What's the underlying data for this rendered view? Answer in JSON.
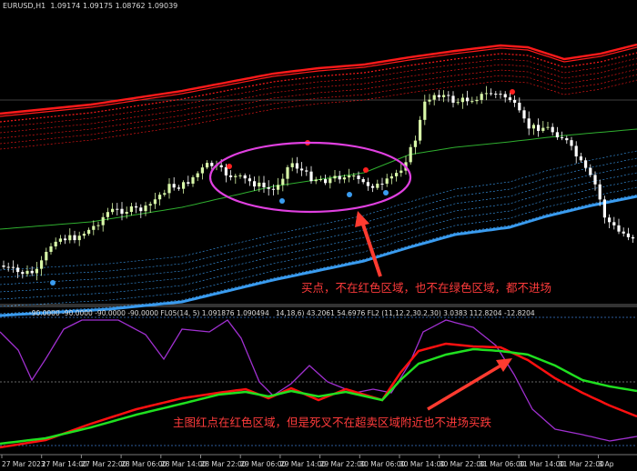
{
  "window": {
    "symbol": "EURUSD,H1",
    "ohlc": "1.09174 1.09175 1.08762 1.09039"
  },
  "indicator": {
    "header": "-90.0000 -90.0000 -90.0000 -90.0000 FL05(14, 5) 1.091876 1.090494",
    "header_right": "14,18,6) 43.2061 54.6976 FL2 (11,12.2,30.2,30) 3.0383 112.8204 -12.8204"
  },
  "time_axis": [
    "27 Mar 2023",
    "27 Mar 14:00",
    "27 Mar 22:00",
    "28 Mar 06:00",
    "28 Mar 14:00",
    "28 Mar 22:00",
    "29 Mar 06:00",
    "29 Mar 14:00",
    "29 Mar 22:00",
    "30 Mar 06:00",
    "30 Mar 14:00",
    "30 Mar 22:00",
    "31 Mar 06:00",
    "31 Mar 14:00",
    "31 Mar 22:00",
    "3 Ap"
  ],
  "annotations": {
    "top": "买点，不在红色区域，也不在绿色区域，都不进场",
    "bottom": "主图红点在红色区域，但是死叉不在超卖区域附近也不进场买跌"
  },
  "colors": {
    "background": "#000000",
    "bull_candle": "#d8f7a8",
    "bear_candle": "#ffffff",
    "upper_band": "#ff1a1a",
    "lower_band": "#3a9cf0",
    "midline": "#2fae2f",
    "ellipse": "#e040e0",
    "fast_line": "#20e020",
    "slow_line": "#ff1010",
    "osc_line": "#a030d0",
    "arrow": "#ff3b30",
    "text": "#dcdcdc"
  },
  "signals": {
    "sell_dots": 5,
    "buy_dots": 4
  }
}
